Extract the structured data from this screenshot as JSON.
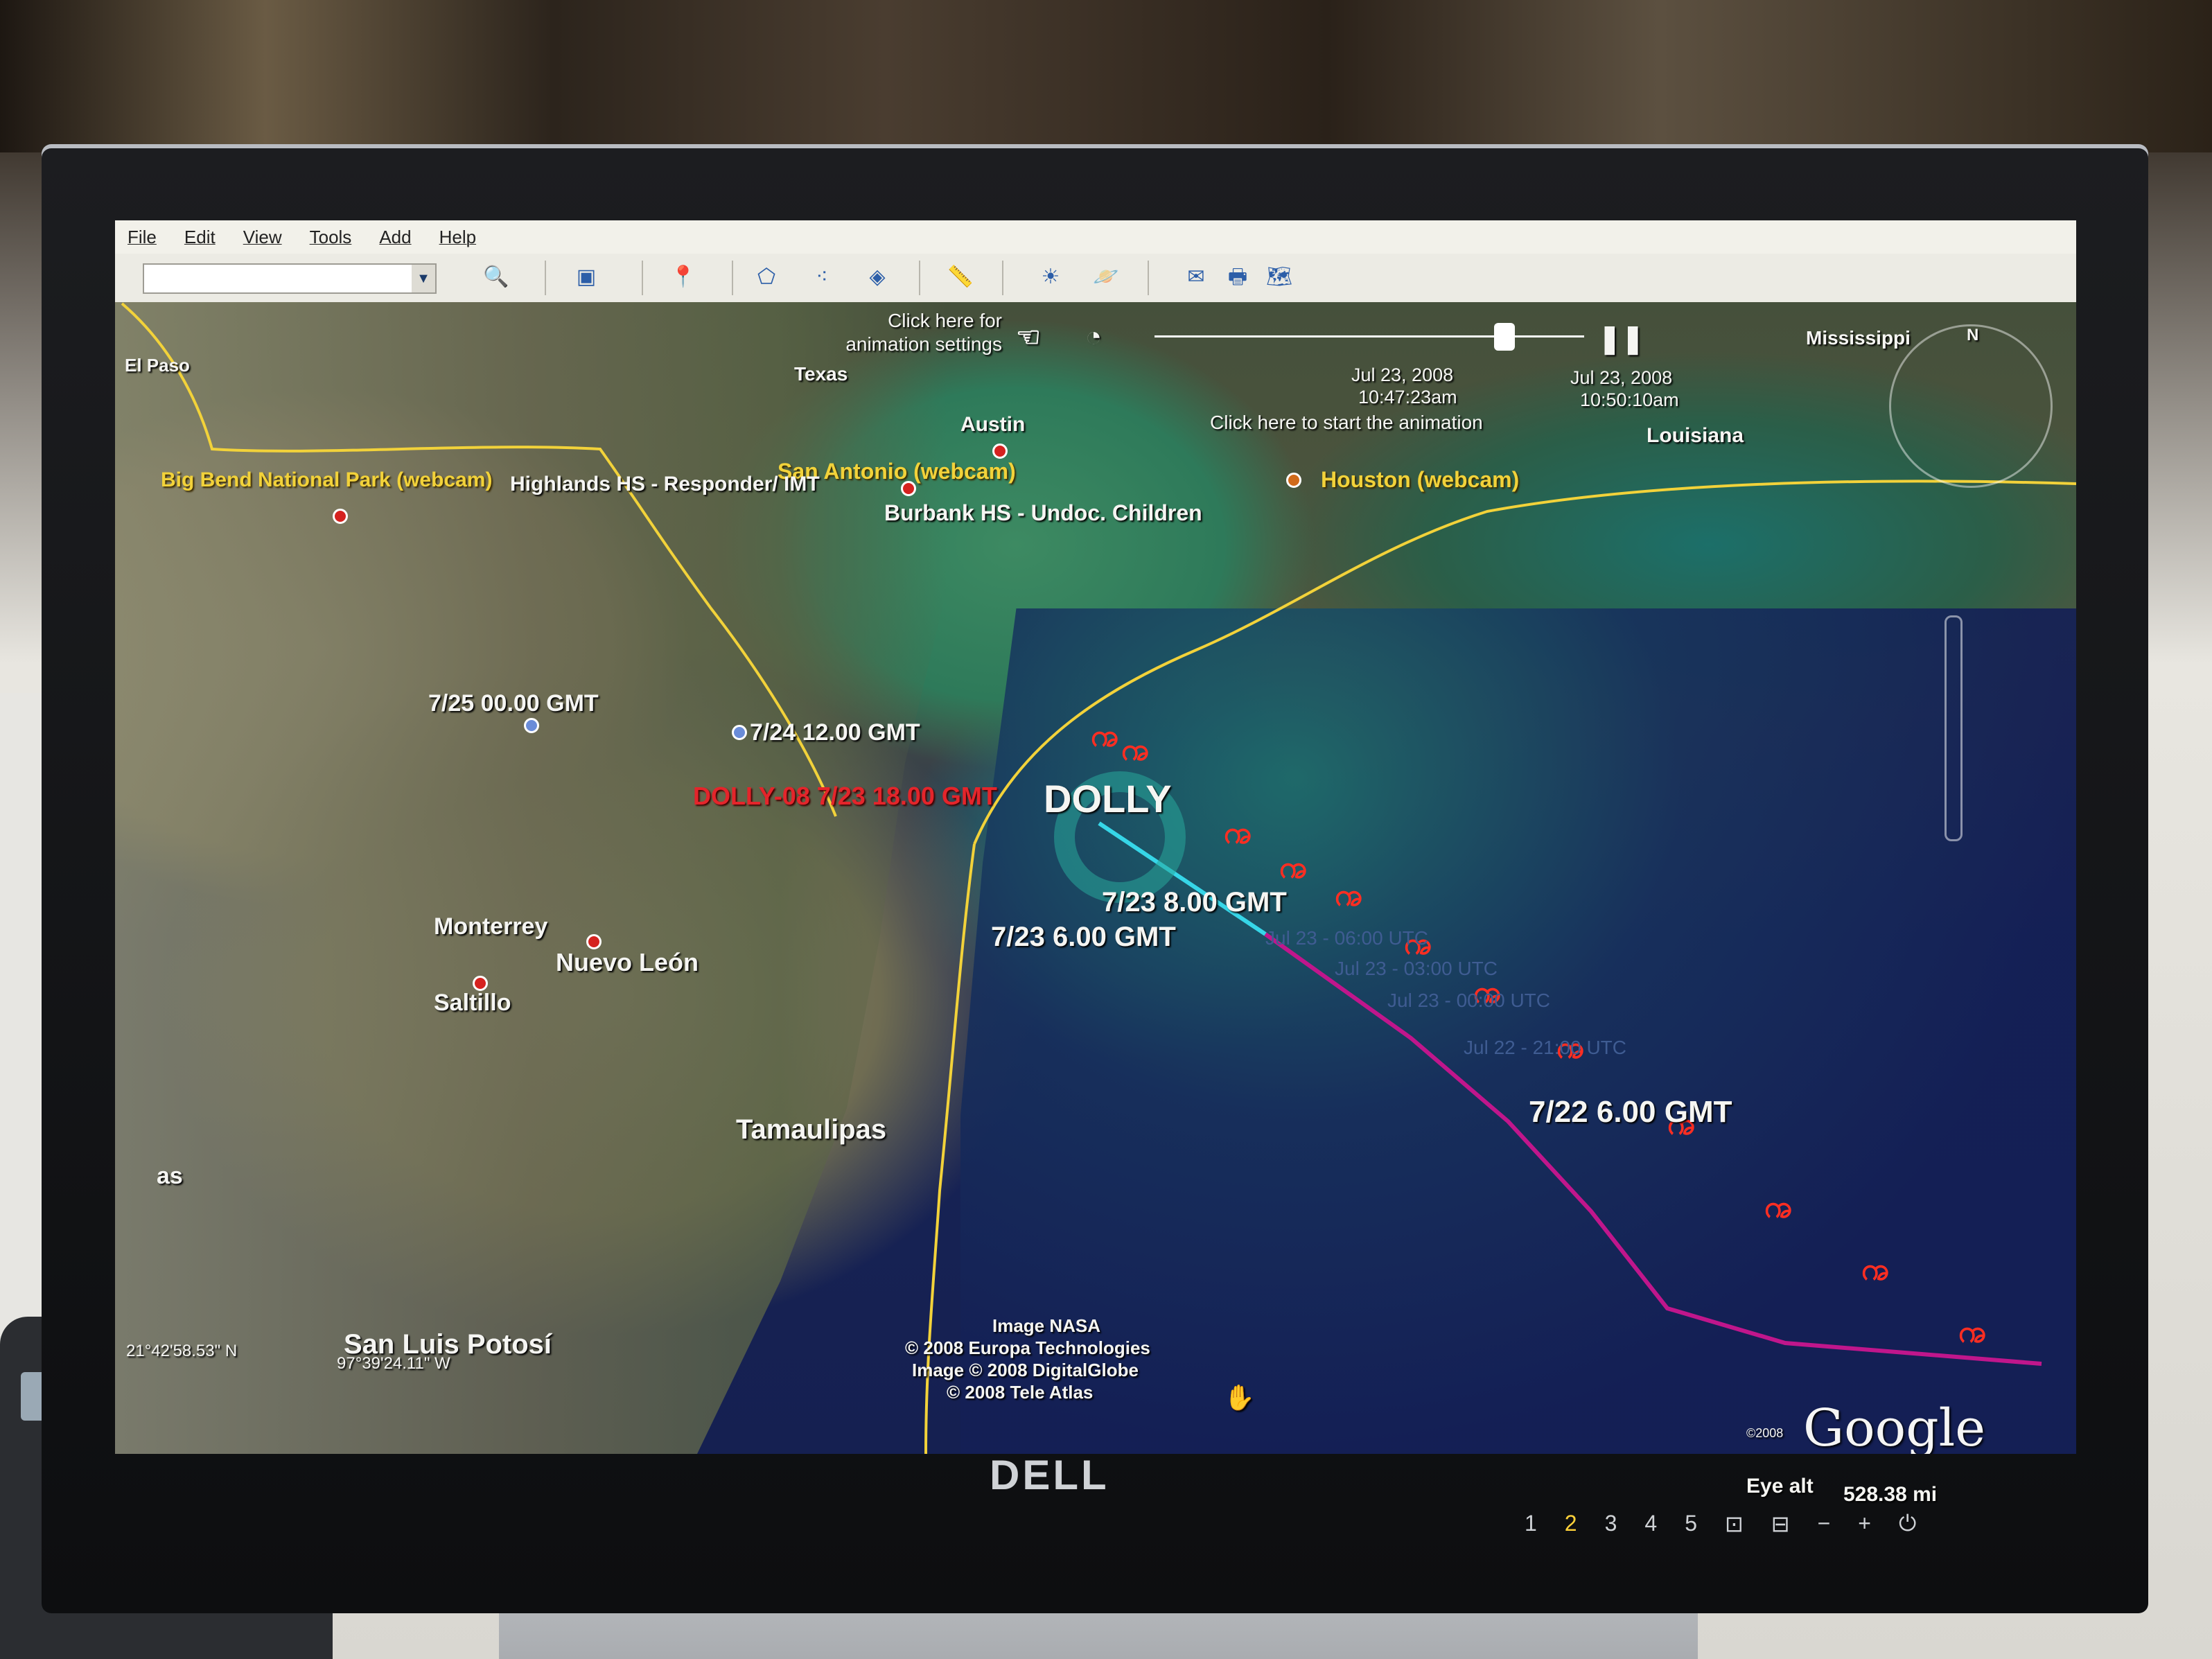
{
  "menu": [
    "File",
    "Edit",
    "View",
    "Tools",
    "Add",
    "Help"
  ],
  "icons": [
    "search-icon",
    "sidebar-icon",
    "placemark-icon",
    "polygon-icon",
    "path-icon",
    "overlay-icon",
    "ruler-icon",
    "sun-icon",
    "planet-icon",
    "email-icon",
    "print-icon",
    "map-icon"
  ],
  "animation": {
    "settings_hint": "Click here for animation settings",
    "start_hint": "Click here to start the animation",
    "date_start": "Jul 23, 2008",
    "time_start": "10:47:23am",
    "date_end": "Jul 23, 2008",
    "time_end": "10:50:10am"
  },
  "places": {
    "el_paso": "El Paso",
    "texas": "Texas",
    "austin": "Austin",
    "san_antonio": "San Antonio (webcam)",
    "houston": "Houston (webcam)",
    "big_bend": "Big Bend National Park (webcam)",
    "highlands": "Highlands HS - Responder/ IMT",
    "burbank": "Burbank HS - Undoc. Children",
    "mississippi": "Mississippi",
    "louisiana": "Louisiana",
    "monterrey": "Monterrey",
    "nuevo_leon": "Nuevo León",
    "saltillo": "Saltillo",
    "tamaulipas": "Tamaulipas",
    "san_luis": "San Luis Potosí",
    "edge_as": "as"
  },
  "track": {
    "storm_name": "DOLLY",
    "label_0725": "7/25 00.00 GMT",
    "label_0724": "7/24 12.00 GMT",
    "label_dolly08": "DOLLY-08 7/23 18.00 GMT",
    "label_0723_18": "7/23 8.00 GMT",
    "label_0723_6": "7/23 6.00 GMT",
    "label_0722_6": "7/22 6.00 GMT",
    "utc_1": "Jul 23 - 06:00 UTC",
    "utc_2": "Jul 23 - 03:00 UTC",
    "utc_3": "Jul 23 - 00:00 UTC",
    "utc_4": "Jul 22 - 21:00 UTC"
  },
  "credits": [
    "Image NASA",
    "© 2008 Europa Technologies",
    "Image © 2008 DigitalGlobe",
    "© 2008 Tele Atlas"
  ],
  "coords": {
    "lat": "21°42'58.53\" N",
    "lon": "97°39'24.11\" W"
  },
  "eye_alt_label": "Eye alt",
  "eye_alt_value": "528.38 mi",
  "google_year": "©2008",
  "google": "Google",
  "dell": "DELL",
  "monitor_buttons": [
    "1",
    "2",
    "3",
    "4",
    "5"
  ],
  "colors": {
    "storm_red": "#ff2e22",
    "track_cyan": "#36d6e8",
    "track_magenta": "#c0168c",
    "border_yellow": "#f2d23a"
  }
}
